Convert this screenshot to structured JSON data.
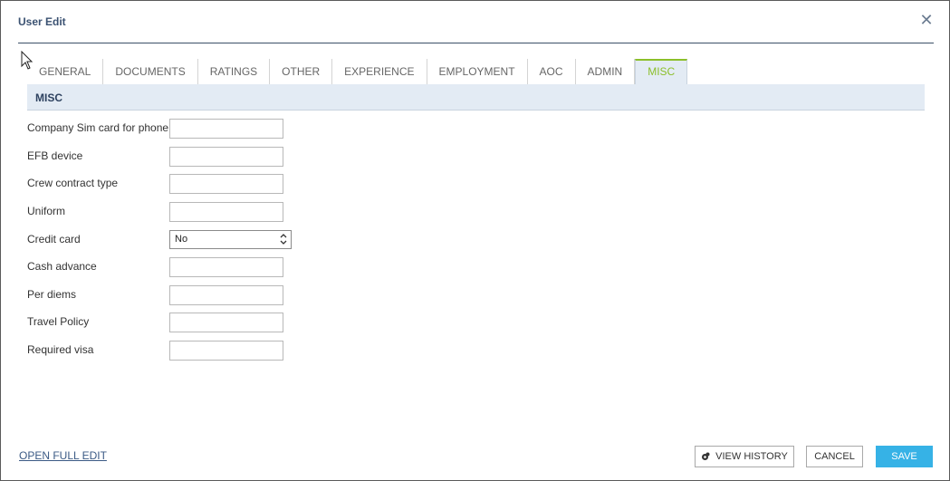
{
  "dialog": {
    "title": "User Edit",
    "close_glyph": "✕"
  },
  "tabs": [
    {
      "label": "GENERAL",
      "active": false
    },
    {
      "label": "DOCUMENTS",
      "active": false
    },
    {
      "label": "RATINGS",
      "active": false
    },
    {
      "label": "OTHER",
      "active": false
    },
    {
      "label": "EXPERIENCE",
      "active": false
    },
    {
      "label": "EMPLOYMENT",
      "active": false
    },
    {
      "label": "AOC",
      "active": false
    },
    {
      "label": "ADMIN",
      "active": false
    },
    {
      "label": "MISC",
      "active": true
    }
  ],
  "section": {
    "title": "MISC"
  },
  "fields": [
    {
      "label": "Company Sim card for phone",
      "value": "",
      "type": "text"
    },
    {
      "label": "EFB device",
      "value": "",
      "type": "text"
    },
    {
      "label": "Crew contract type",
      "value": "",
      "type": "text"
    },
    {
      "label": "Uniform",
      "value": "",
      "type": "text"
    },
    {
      "label": "Credit card",
      "value": "No",
      "type": "select"
    },
    {
      "label": "Cash advance",
      "value": "",
      "type": "text"
    },
    {
      "label": "Per diems",
      "value": "",
      "type": "text"
    },
    {
      "label": "Travel Policy",
      "value": "",
      "type": "text"
    },
    {
      "label": "Required visa",
      "value": "",
      "type": "text"
    }
  ],
  "footer": {
    "open_full_edit": "OPEN FULL EDIT",
    "view_history": "VIEW HISTORY",
    "cancel": "CANCEL",
    "save": "SAVE"
  },
  "colors": {
    "accent_green": "#8cbf2b",
    "save_blue": "#36b2e6",
    "title_navy": "#3b5272",
    "section_bg": "#e3ebf4"
  }
}
